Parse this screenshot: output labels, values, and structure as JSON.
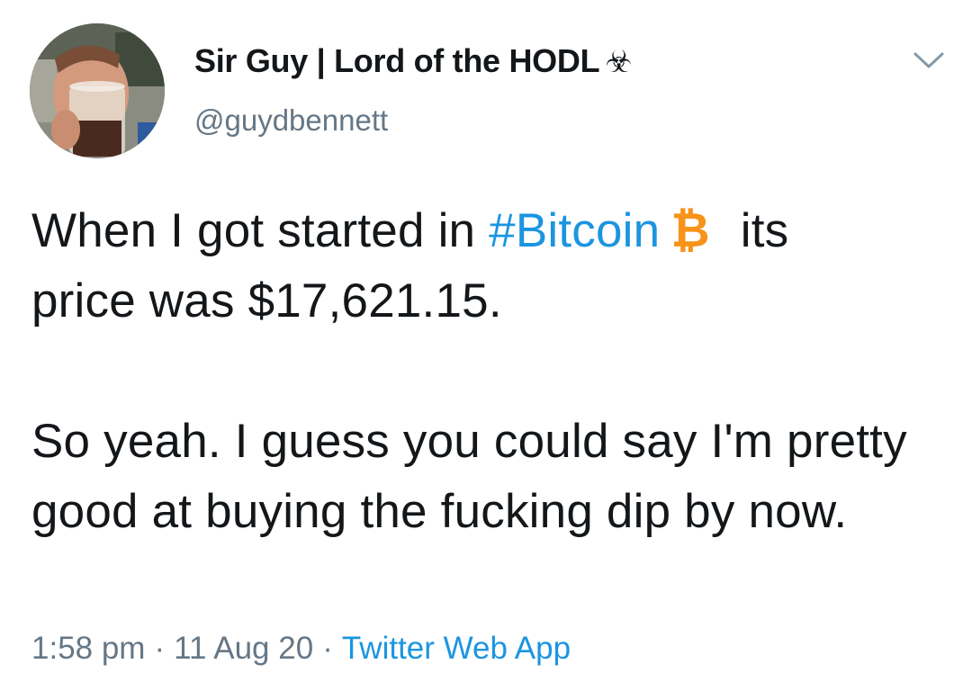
{
  "tweet": {
    "author": {
      "display_name": "Sir Guy | Lord of the HODL",
      "name_emoji": "☣",
      "handle": "@guydbennett"
    },
    "icons": {
      "avatar": "profile-photo",
      "menu": "chevron-down-icon",
      "currency": "bitcoin-icon"
    },
    "text": {
      "part1": "When I got started in ",
      "hashtag": "#Bitcoin",
      "btc_symbol": "₿",
      "part2": "its",
      "line2": "price was $17,621.15.",
      "paragraph2": "So yeah.  I guess you could say I'm pretty good at buying the fucking dip by now."
    },
    "meta": {
      "time": "1:58 pm",
      "date": "11 Aug 20",
      "separator": "·",
      "source": "Twitter Web App"
    },
    "colors": {
      "link": "#1b95e0",
      "secondary_text": "#657786",
      "bitcoin": "#f7931a"
    }
  }
}
